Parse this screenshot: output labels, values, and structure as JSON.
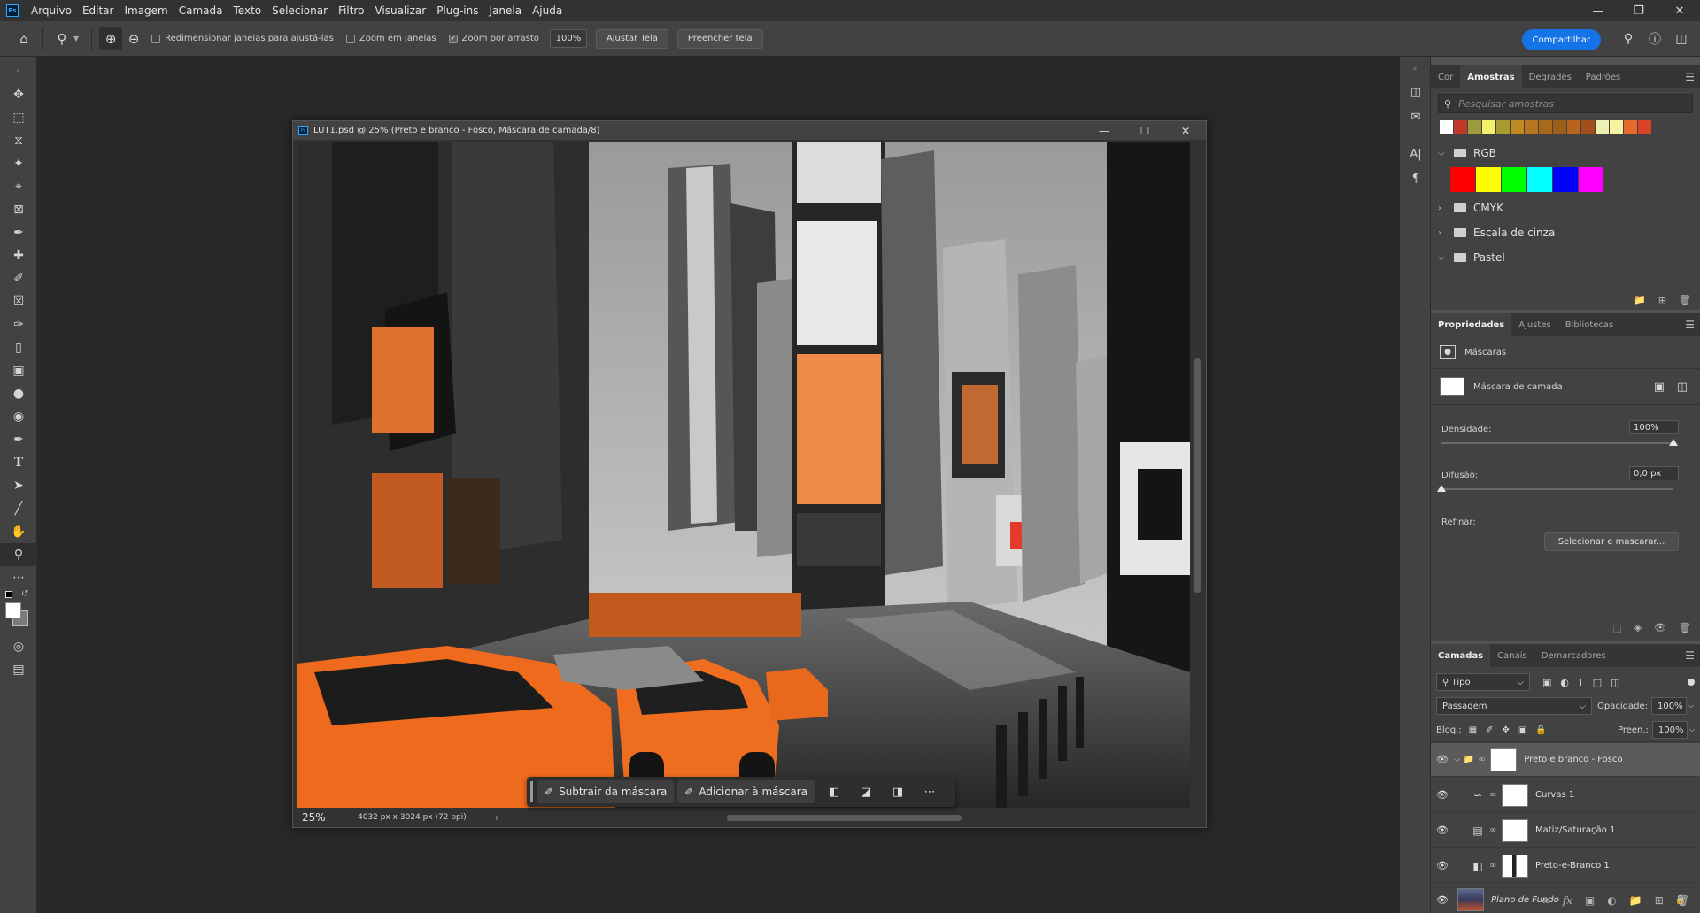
{
  "menu": {
    "items": [
      "Arquivo",
      "Editar",
      "Imagem",
      "Camada",
      "Texto",
      "Selecionar",
      "Filtro",
      "Visualizar",
      "Plug-ins",
      "Janela",
      "Ajuda"
    ]
  },
  "options": {
    "resize_windows": "Redimensionar janelas para ajustá-las",
    "zoom_all_windows": "Zoom em Janelas",
    "scrubby_zoom": "Zoom por arrasto",
    "zoom_value": "100%",
    "fit_screen": "Ajustar Tela",
    "fill_screen": "Preencher tela",
    "share": "Compartilhar"
  },
  "document": {
    "title": "LUT1.psd @ 25% (Preto e branco - Fosco, Máscara de camada/8)",
    "zoom": "25%",
    "dimensions": "4032 px x 3024 px (72 ppi)"
  },
  "taskbar": {
    "subtract": "Subtrair da máscara",
    "add": "Adicionar à máscara"
  },
  "swatches": {
    "tabs": [
      "Cor",
      "Amostras",
      "Degradês",
      "Padrões"
    ],
    "active_tab": 1,
    "search_placeholder": "Pesquisar amostras",
    "recent_colors": [
      "#ffffff",
      "#c0392b",
      "#9c9c3a",
      "#f3f06a",
      "#a89b30",
      "#c08a22",
      "#b7751e",
      "#a8691c",
      "#9c5e1a",
      "#b8641f",
      "#a04e1a",
      "#ecf0b0",
      "#f6f2a0",
      "#e86a2b",
      "#d8432a"
    ],
    "groups": [
      "RGB",
      "CMYK",
      "Escala de cinza",
      "Pastel"
    ],
    "rgb_colors": [
      "#ff0000",
      "#ffff00",
      "#00ff00",
      "#00ffff",
      "#0000ff",
      "#ff00ff"
    ]
  },
  "properties": {
    "tabs": [
      "Propriedades",
      "Ajustes",
      "Bibliotecas"
    ],
    "active_tab": 0,
    "section": "Máscaras",
    "mask_label": "Máscara de camada",
    "density_label": "Densidade:",
    "density_value": "100%",
    "density": 1.0,
    "feather_label": "Difusão:",
    "feather_value": "0,0 px",
    "feather": 0.0,
    "refine_label": "Refinar:",
    "select_mask": "Selecionar e mascarar..."
  },
  "layers": {
    "tabs": [
      "Camadas",
      "Canais",
      "Demarcadores"
    ],
    "active_tab": 0,
    "filter": "Tipo",
    "blend_mode": "Passagem",
    "opacity_label": "Opacidade:",
    "opacity": "100%",
    "lock_label": "Bloq.:",
    "fill_label": "Preen.:",
    "fill": "100%",
    "items": [
      {
        "name": "Preto e branco - Fosco",
        "kind": "group",
        "selected": true
      },
      {
        "name": "Curvas 1",
        "kind": "adjustment"
      },
      {
        "name": "Matiz/Saturação 1",
        "kind": "adjustment"
      },
      {
        "name": "Preto-e-Branco 1",
        "kind": "adjustment"
      },
      {
        "name": "Plano de Fundo",
        "kind": "background"
      }
    ]
  }
}
